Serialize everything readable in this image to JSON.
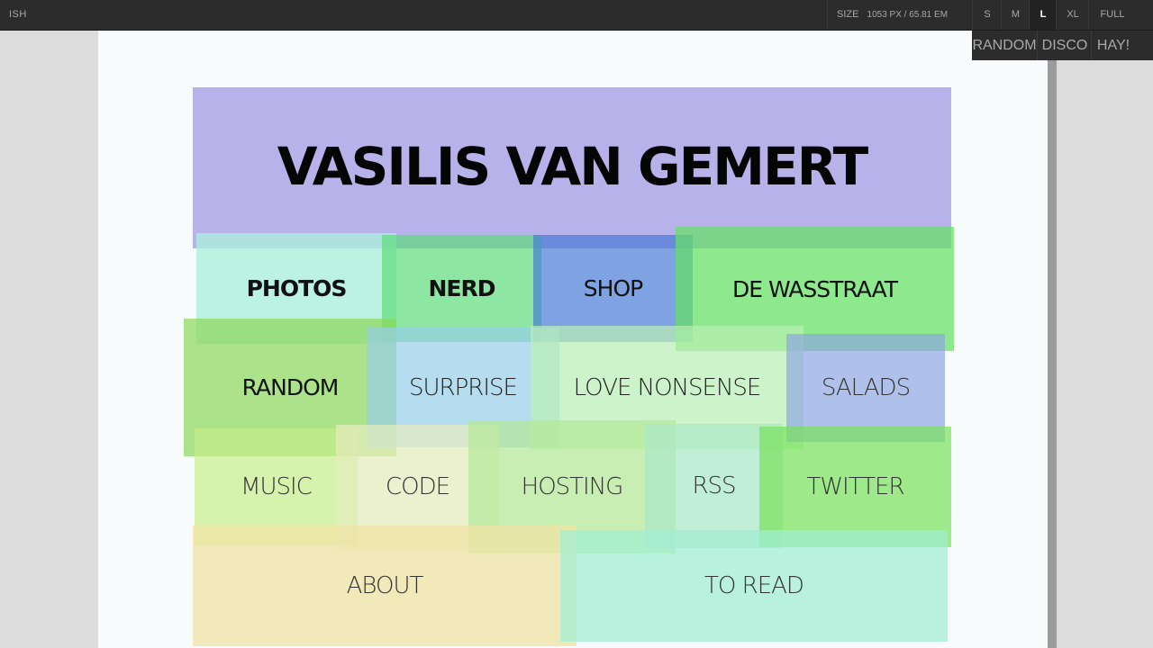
{
  "toolbar": {
    "logo": "ISH",
    "size_label": "SIZE",
    "size_value": "1053 PX /  65.81 EM",
    "sizes": [
      "S",
      "M",
      "L",
      "XL",
      "FULL"
    ],
    "active_size": "L",
    "menu": [
      "RANDOM",
      "DISCO",
      "HAY!"
    ]
  },
  "site": {
    "title": "VASILIS VAN GEMERT",
    "nav": {
      "photos": "PHOTOS",
      "nerd": "NERD",
      "shop": "SHOP",
      "wasstraat": "DE WASSTRAAT",
      "random": "RANDOM",
      "surprise": "SURPRISE",
      "love_nonsense": "LOVE NONSENSE",
      "salads": "SALADS",
      "music": "MUSIC",
      "code": "CODE",
      "hosting": "HOSTING",
      "rss": "RSS",
      "twitter": "TWITTER",
      "about": "ABOUT",
      "to_read": "TO READ"
    }
  },
  "colors": {
    "header": "#a096e4",
    "mint": "#aef0da",
    "green": "#6ee57a",
    "blue": "#5a8fe0",
    "grass": "#7ee06a",
    "light_blue": "#b0dcf0",
    "pale_green": "#c8f0c4",
    "lavender": "#a8b8ec",
    "lime": "#d6f2a8",
    "cream": "#eef2c8",
    "sand": "#f0e4a8",
    "aqua": "#a6eed8"
  }
}
